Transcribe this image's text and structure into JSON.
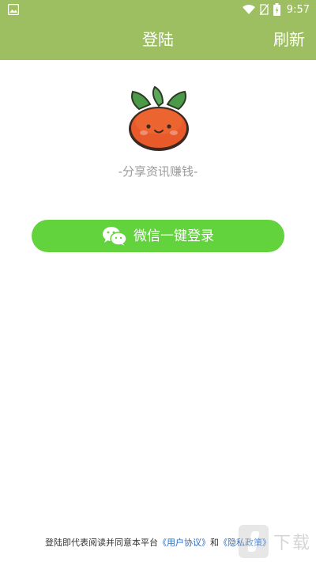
{
  "status_bar": {
    "time": "9:57",
    "icons": [
      "image-icon",
      "wifi-icon",
      "no-sim-icon",
      "battery-charging-icon"
    ]
  },
  "header": {
    "title": "登陆",
    "refresh_label": "刷新",
    "background_color": "#9dbf62"
  },
  "main": {
    "logo_icon": "persimmon-mascot-icon",
    "slogan": "-分享资讯赚钱-",
    "wechat_login_label": "一键登录",
    "wechat_login_full_label": "微信一键登录",
    "button_color": "#62d33d"
  },
  "footer": {
    "agreement_prefix": "登陆即代表阅读并同意本平台",
    "user_agreement": "《用户协议》",
    "and": "和",
    "privacy_policy": "《隐私政策》"
  },
  "watermark": {
    "text": "下载"
  }
}
